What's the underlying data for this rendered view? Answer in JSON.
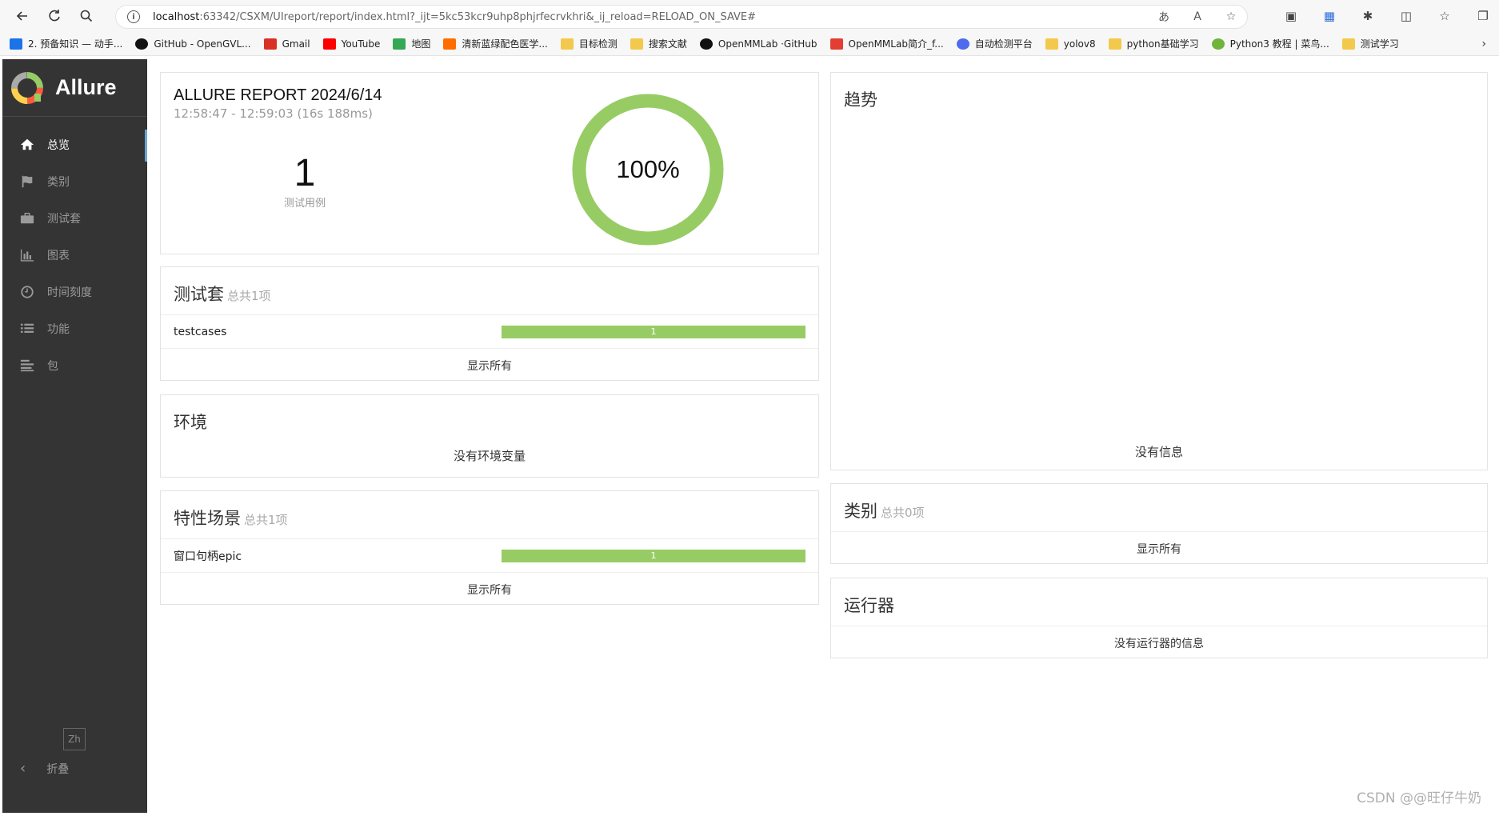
{
  "browser": {
    "url_host": "localhost",
    "url_rest": ":63342/CSXM/UIreport/report/index.html?_ijt=5kc53kcr9uhp8phjrfecrvkhri&_ij_reload=RELOAD_ON_SAVE#",
    "bookmarks": [
      {
        "label": "2. 预备知识 — 动手...",
        "icon": "book-icon",
        "color": "#1a73e8"
      },
      {
        "label": "GitHub - OpenGVL...",
        "icon": "github-icon",
        "color": "#111111"
      },
      {
        "label": "Gmail",
        "icon": "gmail-icon",
        "color": "#d93025"
      },
      {
        "label": "YouTube",
        "icon": "youtube-icon",
        "color": "#ff0000"
      },
      {
        "label": "地图",
        "icon": "maps-icon",
        "color": "#34a853"
      },
      {
        "label": "清新蓝绿配色医学...",
        "icon": "bookmark-icon",
        "color": "#ff6d00"
      },
      {
        "label": "目标检测",
        "icon": "folder-icon",
        "color": "#f2c94c"
      },
      {
        "label": "搜索文献",
        "icon": "folder-icon",
        "color": "#f2c94c"
      },
      {
        "label": "OpenMMLab ·GitHub",
        "icon": "github-icon",
        "color": "#111111"
      },
      {
        "label": "OpenMMLab简介_f...",
        "icon": "csdn-icon",
        "color": "#e33e33"
      },
      {
        "label": "自动检测平台",
        "icon": "globe-icon",
        "color": "#4f6bed"
      },
      {
        "label": "yolov8",
        "icon": "folder-icon",
        "color": "#f2c94c"
      },
      {
        "label": "python基础学习",
        "icon": "folder-icon",
        "color": "#f2c94c"
      },
      {
        "label": "Python3 教程 | 菜鸟...",
        "icon": "runoob-icon",
        "color": "#6fb53b"
      },
      {
        "label": "测试学习",
        "icon": "folder-icon",
        "color": "#f2c94c"
      }
    ]
  },
  "sidebar": {
    "brand": "Allure",
    "items": [
      {
        "label": "总览",
        "icon": "home-icon"
      },
      {
        "label": "类别",
        "icon": "flag-icon"
      },
      {
        "label": "测试套",
        "icon": "briefcase-icon"
      },
      {
        "label": "图表",
        "icon": "bar-chart-icon"
      },
      {
        "label": "时间刻度",
        "icon": "clock-icon"
      },
      {
        "label": "功能",
        "icon": "list-icon"
      },
      {
        "label": "包",
        "icon": "align-left-icon"
      }
    ],
    "lang": "Zh",
    "collapse": "折叠"
  },
  "summary": {
    "title": "ALLURE REPORT 2024/6/14",
    "time": "12:58:47 - 12:59:03 (16s 188ms)",
    "test_count": "1",
    "test_count_label": "测试用例",
    "percent": "100%",
    "pass_fraction": 1.0,
    "pass_color": "#97cc64"
  },
  "suites": {
    "title": "测试套",
    "count": "总共1项",
    "rows": [
      {
        "name": "testcases",
        "value": "1",
        "fraction": 1.0
      }
    ],
    "show_all": "显示所有"
  },
  "environment": {
    "title": "环境",
    "empty": "没有环境变量"
  },
  "features": {
    "title": "特性场景",
    "count": "总共1项",
    "rows": [
      {
        "name": "窗口句柄epic",
        "value": "1",
        "fraction": 1.0
      }
    ],
    "show_all": "显示所有"
  },
  "trend": {
    "title": "趋势",
    "empty": "没有信息"
  },
  "categories": {
    "title": "类别",
    "count": "总共0项",
    "show_all": "显示所有"
  },
  "executors": {
    "title": "运行器",
    "empty": "没有运行器的信息"
  },
  "watermark": "CSDN @@旺仔牛奶"
}
